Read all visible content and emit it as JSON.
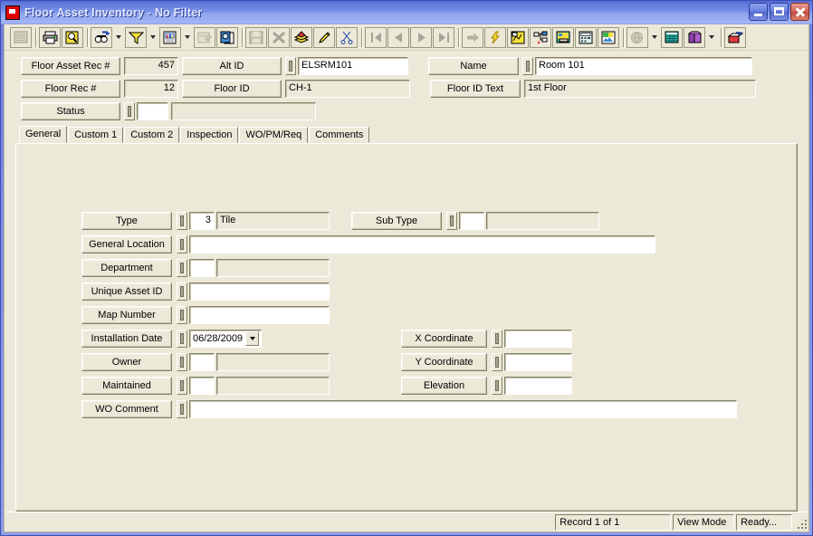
{
  "window": {
    "title": "Floor Asset Inventory - No Filter",
    "icon": "app-icon",
    "minimize_label": "",
    "maximize_label": "",
    "close_label": ""
  },
  "toolbar": {
    "buttons": [
      {
        "name": "new-record-icon",
        "disabled": true
      },
      {
        "name": "print-icon",
        "disabled": false
      },
      {
        "name": "print-preview-icon",
        "disabled": false
      },
      {
        "name": "find-icon",
        "disabled": false
      },
      {
        "name": "filter-icon",
        "disabled": false
      },
      {
        "name": "report-icon",
        "disabled": false
      },
      {
        "name": "form-properties-icon",
        "disabled": true
      },
      {
        "name": "copy-record-icon",
        "disabled": false
      },
      {
        "name": "save-icon",
        "disabled": true
      },
      {
        "name": "delete-icon",
        "disabled": true
      },
      {
        "name": "layers-icon",
        "disabled": false
      },
      {
        "name": "edit-pencil-icon",
        "disabled": false
      },
      {
        "name": "cut-scissors-icon",
        "disabled": false
      },
      {
        "name": "first-record-icon",
        "disabled": true
      },
      {
        "name": "previous-record-icon",
        "disabled": true
      },
      {
        "name": "next-record-icon",
        "disabled": true
      },
      {
        "name": "last-record-icon",
        "disabled": true
      },
      {
        "name": "goto-record-icon",
        "disabled": true
      },
      {
        "name": "quick-action-icon",
        "disabled": false
      },
      {
        "name": "map-link-icon",
        "disabled": false
      },
      {
        "name": "tree-view-icon",
        "disabled": false
      },
      {
        "name": "gis-icon",
        "disabled": false
      },
      {
        "name": "calculator-icon",
        "disabled": false
      },
      {
        "name": "image-icon",
        "disabled": false
      },
      {
        "name": "globe-icon",
        "disabled": true
      },
      {
        "name": "grid-icon",
        "disabled": false
      },
      {
        "name": "book-icon",
        "disabled": false
      },
      {
        "name": "exit-icon",
        "disabled": false
      }
    ]
  },
  "header": {
    "floor_asset_rec_label": "Floor Asset Rec #",
    "floor_asset_rec_value": "457",
    "alt_id_label": "Alt ID",
    "alt_id_value": "ELSRM101",
    "name_label": "Name",
    "name_value": "Room 101",
    "floor_rec_label": "Floor Rec #",
    "floor_rec_value": "12",
    "floor_id_label": "Floor ID",
    "floor_id_value": "CH-1",
    "floor_id_text_label": "Floor ID Text",
    "floor_id_text_value": "1st Floor",
    "status_label": "Status",
    "status_code": "",
    "status_desc": ""
  },
  "tabs": [
    {
      "label": "General",
      "active": true
    },
    {
      "label": "Custom 1",
      "active": false
    },
    {
      "label": "Custom 2",
      "active": false
    },
    {
      "label": "Inspection",
      "active": false
    },
    {
      "label": "WO/PM/Req",
      "active": false
    },
    {
      "label": "Comments",
      "active": false
    }
  ],
  "general": {
    "type_label": "Type",
    "type_code": "3",
    "type_desc": "Tile",
    "sub_type_label": "Sub Type",
    "sub_type_code": "",
    "sub_type_desc": "",
    "general_location_label": "General Location",
    "general_location_value": "",
    "department_label": "Department",
    "department_code": "",
    "department_desc": "",
    "unique_asset_id_label": "Unique Asset ID",
    "unique_asset_id_value": "",
    "map_number_label": "Map Number",
    "map_number_value": "",
    "installation_date_label": "Installation Date",
    "installation_date_value": "06/28/2009",
    "owner_label": "Owner",
    "owner_code": "",
    "owner_desc": "",
    "maintained_label": "Maintained",
    "maintained_code": "",
    "maintained_desc": "",
    "wo_comment_label": "WO Comment",
    "wo_comment_value": "",
    "x_coordinate_label": "X Coordinate",
    "x_coordinate_value": "",
    "y_coordinate_label": "Y Coordinate",
    "y_coordinate_value": "",
    "elevation_label": "Elevation",
    "elevation_value": ""
  },
  "statusbar": {
    "record_position": "Record 1 of 1",
    "mode": "View Mode",
    "state": "Ready..."
  },
  "colors": {
    "titlebar_blue": "#7d93e8",
    "face": "#ece9d8",
    "shadow": "#85826b",
    "close_red": "#c04b3e"
  }
}
